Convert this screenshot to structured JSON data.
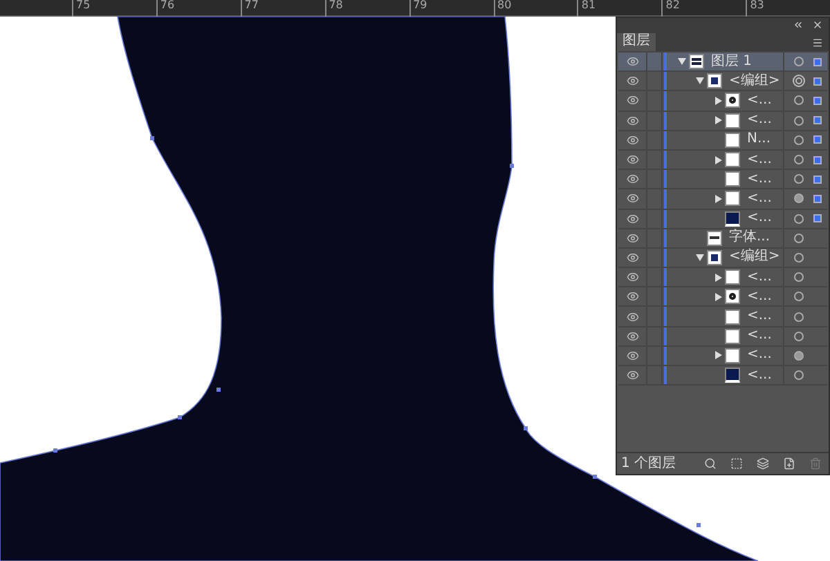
{
  "ruler": {
    "labels": [
      "75",
      "76",
      "77",
      "78",
      "79",
      "80",
      "81",
      "82",
      "83"
    ]
  },
  "layers_panel": {
    "tab": "图层",
    "footer_text": "1 个图层",
    "layers": [
      {
        "name": "图层 1",
        "current": true,
        "expanded": true,
        "thumb": {
          "kind": "layer"
        },
        "target": {
          "kind": "ring"
        },
        "selected": true,
        "children": [
          {
            "name": "<编组>",
            "expanded": true,
            "thumb": {
              "kind": "group"
            },
            "target": {
              "kind": "double"
            },
            "selected": true,
            "children": [
              {
                "name": "<...",
                "expanded": false,
                "thumb": {
                  "kind": "pattern"
                },
                "target": {
                  "kind": "ring"
                },
                "selected": true
              },
              {
                "name": "<...",
                "expanded": false,
                "thumb": {
                  "kind": "white"
                },
                "target": {
                  "kind": "ring"
                },
                "selected": true
              },
              {
                "name": "N...",
                "thumb": {
                  "kind": "white"
                },
                "target": {
                  "kind": "ring"
                },
                "selected": true
              },
              {
                "name": "<...",
                "expanded": false,
                "thumb": {
                  "kind": "white"
                },
                "target": {
                  "kind": "ring"
                },
                "selected": true
              },
              {
                "name": "<...",
                "thumb": {
                  "kind": "white"
                },
                "target": {
                  "kind": "ring"
                },
                "selected": true
              },
              {
                "name": "<...",
                "expanded": false,
                "thumb": {
                  "kind": "white"
                },
                "target": {
                  "kind": "filled"
                },
                "selected": true
              },
              {
                "name": "<...",
                "thumb": {
                  "kind": "dark"
                },
                "target": {
                  "kind": "ring"
                },
                "selected": true
              }
            ]
          },
          {
            "name": "字体...",
            "thumb": {
              "kind": "text"
            },
            "target": {
              "kind": "ring"
            },
            "selected": false
          },
          {
            "name": "<编组>",
            "expanded": true,
            "thumb": {
              "kind": "group"
            },
            "target": {
              "kind": "ring"
            },
            "selected": false,
            "children": [
              {
                "name": "<...",
                "expanded": false,
                "thumb": {
                  "kind": "white"
                },
                "target": {
                  "kind": "ring"
                },
                "selected": false
              },
              {
                "name": "<...",
                "expanded": false,
                "thumb": {
                  "kind": "pattern"
                },
                "target": {
                  "kind": "ring"
                },
                "selected": false
              },
              {
                "name": "<...",
                "thumb": {
                  "kind": "white"
                },
                "target": {
                  "kind": "ring"
                },
                "selected": false
              },
              {
                "name": "<...",
                "thumb": {
                  "kind": "white"
                },
                "target": {
                  "kind": "ring"
                },
                "selected": false
              },
              {
                "name": "<...",
                "expanded": false,
                "thumb": {
                  "kind": "white"
                },
                "target": {
                  "kind": "filled"
                },
                "selected": false
              },
              {
                "name": "<...",
                "thumb": {
                  "kind": "dark"
                },
                "target": {
                  "kind": "ring"
                },
                "selected": false
              }
            ]
          }
        ]
      }
    ]
  }
}
